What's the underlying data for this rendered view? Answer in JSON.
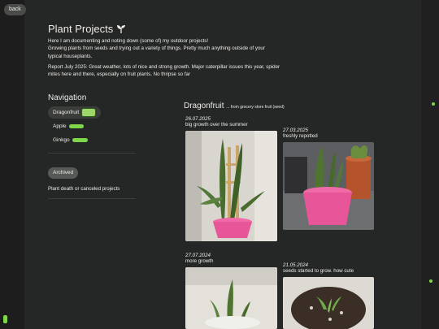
{
  "back_label": "back",
  "title": "Plant Projects",
  "intro": {
    "p1_line1": "Here I am documenting and noting down (some of) my outdoor projects!",
    "p1_line2": "Growing plants from seeds and trying out a variety of things. Pretty much anything outside of your",
    "p1_line3": "typical houseplants.",
    "p2_line1": "Report July 2025: Great weather, lots of nice and strong growth. Major caterpillar issues this year, spider",
    "p2_line2": "mites here and there, especially on fruit plants. No thripse so far"
  },
  "navigation": {
    "heading": "Navigation",
    "items": [
      {
        "label": "Dragonfruit",
        "active": true
      },
      {
        "label": "Apple",
        "active": false
      },
      {
        "label": "Ginkgo",
        "active": false
      }
    ]
  },
  "archived": {
    "label": "Archived",
    "note": "Plant death or canceled projects"
  },
  "section": {
    "title": "Dragonfruit",
    "subtitle": "... from grocery store fruit (seed)"
  },
  "entries": [
    {
      "date": "26.07.2025",
      "caption": "big growth over the summer"
    },
    {
      "date": "27.03.2025",
      "caption": "freshly repotted"
    },
    {
      "date": "27.07.2024",
      "caption": "more growth"
    },
    {
      "date": "21.05.2024",
      "caption": "seeds started to grow. how cute"
    }
  ],
  "colors": {
    "background": "#252726",
    "text": "#ecebe6",
    "accent_green": "#7fd84a",
    "pot_pink": "#e8569a"
  }
}
